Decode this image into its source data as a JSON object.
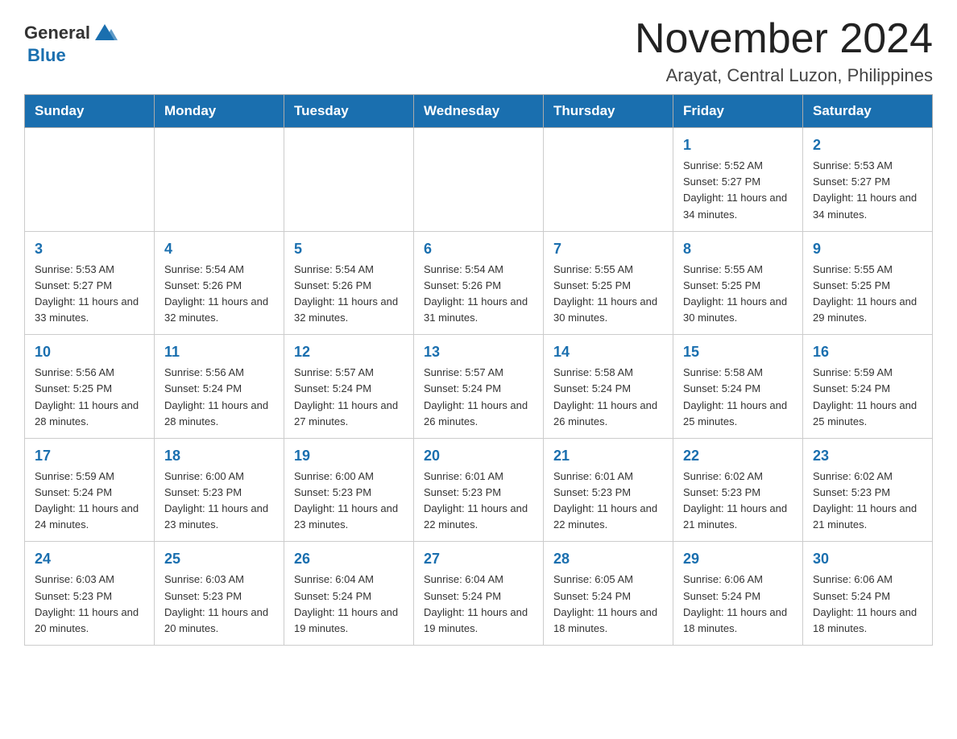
{
  "header": {
    "logo": {
      "text_general": "General",
      "text_blue": "Blue",
      "aria": "GeneralBlue logo"
    },
    "month_title": "November 2024",
    "location": "Arayat, Central Luzon, Philippines"
  },
  "calendar": {
    "days_of_week": [
      "Sunday",
      "Monday",
      "Tuesday",
      "Wednesday",
      "Thursday",
      "Friday",
      "Saturday"
    ],
    "weeks": [
      [
        {
          "day": "",
          "sunrise": "",
          "sunset": "",
          "daylight": ""
        },
        {
          "day": "",
          "sunrise": "",
          "sunset": "",
          "daylight": ""
        },
        {
          "day": "",
          "sunrise": "",
          "sunset": "",
          "daylight": ""
        },
        {
          "day": "",
          "sunrise": "",
          "sunset": "",
          "daylight": ""
        },
        {
          "day": "",
          "sunrise": "",
          "sunset": "",
          "daylight": ""
        },
        {
          "day": "1",
          "sunrise": "Sunrise: 5:52 AM",
          "sunset": "Sunset: 5:27 PM",
          "daylight": "Daylight: 11 hours and 34 minutes."
        },
        {
          "day": "2",
          "sunrise": "Sunrise: 5:53 AM",
          "sunset": "Sunset: 5:27 PM",
          "daylight": "Daylight: 11 hours and 34 minutes."
        }
      ],
      [
        {
          "day": "3",
          "sunrise": "Sunrise: 5:53 AM",
          "sunset": "Sunset: 5:27 PM",
          "daylight": "Daylight: 11 hours and 33 minutes."
        },
        {
          "day": "4",
          "sunrise": "Sunrise: 5:54 AM",
          "sunset": "Sunset: 5:26 PM",
          "daylight": "Daylight: 11 hours and 32 minutes."
        },
        {
          "day": "5",
          "sunrise": "Sunrise: 5:54 AM",
          "sunset": "Sunset: 5:26 PM",
          "daylight": "Daylight: 11 hours and 32 minutes."
        },
        {
          "day": "6",
          "sunrise": "Sunrise: 5:54 AM",
          "sunset": "Sunset: 5:26 PM",
          "daylight": "Daylight: 11 hours and 31 minutes."
        },
        {
          "day": "7",
          "sunrise": "Sunrise: 5:55 AM",
          "sunset": "Sunset: 5:25 PM",
          "daylight": "Daylight: 11 hours and 30 minutes."
        },
        {
          "day": "8",
          "sunrise": "Sunrise: 5:55 AM",
          "sunset": "Sunset: 5:25 PM",
          "daylight": "Daylight: 11 hours and 30 minutes."
        },
        {
          "day": "9",
          "sunrise": "Sunrise: 5:55 AM",
          "sunset": "Sunset: 5:25 PM",
          "daylight": "Daylight: 11 hours and 29 minutes."
        }
      ],
      [
        {
          "day": "10",
          "sunrise": "Sunrise: 5:56 AM",
          "sunset": "Sunset: 5:25 PM",
          "daylight": "Daylight: 11 hours and 28 minutes."
        },
        {
          "day": "11",
          "sunrise": "Sunrise: 5:56 AM",
          "sunset": "Sunset: 5:24 PM",
          "daylight": "Daylight: 11 hours and 28 minutes."
        },
        {
          "day": "12",
          "sunrise": "Sunrise: 5:57 AM",
          "sunset": "Sunset: 5:24 PM",
          "daylight": "Daylight: 11 hours and 27 minutes."
        },
        {
          "day": "13",
          "sunrise": "Sunrise: 5:57 AM",
          "sunset": "Sunset: 5:24 PM",
          "daylight": "Daylight: 11 hours and 26 minutes."
        },
        {
          "day": "14",
          "sunrise": "Sunrise: 5:58 AM",
          "sunset": "Sunset: 5:24 PM",
          "daylight": "Daylight: 11 hours and 26 minutes."
        },
        {
          "day": "15",
          "sunrise": "Sunrise: 5:58 AM",
          "sunset": "Sunset: 5:24 PM",
          "daylight": "Daylight: 11 hours and 25 minutes."
        },
        {
          "day": "16",
          "sunrise": "Sunrise: 5:59 AM",
          "sunset": "Sunset: 5:24 PM",
          "daylight": "Daylight: 11 hours and 25 minutes."
        }
      ],
      [
        {
          "day": "17",
          "sunrise": "Sunrise: 5:59 AM",
          "sunset": "Sunset: 5:24 PM",
          "daylight": "Daylight: 11 hours and 24 minutes."
        },
        {
          "day": "18",
          "sunrise": "Sunrise: 6:00 AM",
          "sunset": "Sunset: 5:23 PM",
          "daylight": "Daylight: 11 hours and 23 minutes."
        },
        {
          "day": "19",
          "sunrise": "Sunrise: 6:00 AM",
          "sunset": "Sunset: 5:23 PM",
          "daylight": "Daylight: 11 hours and 23 minutes."
        },
        {
          "day": "20",
          "sunrise": "Sunrise: 6:01 AM",
          "sunset": "Sunset: 5:23 PM",
          "daylight": "Daylight: 11 hours and 22 minutes."
        },
        {
          "day": "21",
          "sunrise": "Sunrise: 6:01 AM",
          "sunset": "Sunset: 5:23 PM",
          "daylight": "Daylight: 11 hours and 22 minutes."
        },
        {
          "day": "22",
          "sunrise": "Sunrise: 6:02 AM",
          "sunset": "Sunset: 5:23 PM",
          "daylight": "Daylight: 11 hours and 21 minutes."
        },
        {
          "day": "23",
          "sunrise": "Sunrise: 6:02 AM",
          "sunset": "Sunset: 5:23 PM",
          "daylight": "Daylight: 11 hours and 21 minutes."
        }
      ],
      [
        {
          "day": "24",
          "sunrise": "Sunrise: 6:03 AM",
          "sunset": "Sunset: 5:23 PM",
          "daylight": "Daylight: 11 hours and 20 minutes."
        },
        {
          "day": "25",
          "sunrise": "Sunrise: 6:03 AM",
          "sunset": "Sunset: 5:23 PM",
          "daylight": "Daylight: 11 hours and 20 minutes."
        },
        {
          "day": "26",
          "sunrise": "Sunrise: 6:04 AM",
          "sunset": "Sunset: 5:24 PM",
          "daylight": "Daylight: 11 hours and 19 minutes."
        },
        {
          "day": "27",
          "sunrise": "Sunrise: 6:04 AM",
          "sunset": "Sunset: 5:24 PM",
          "daylight": "Daylight: 11 hours and 19 minutes."
        },
        {
          "day": "28",
          "sunrise": "Sunrise: 6:05 AM",
          "sunset": "Sunset: 5:24 PM",
          "daylight": "Daylight: 11 hours and 18 minutes."
        },
        {
          "day": "29",
          "sunrise": "Sunrise: 6:06 AM",
          "sunset": "Sunset: 5:24 PM",
          "daylight": "Daylight: 11 hours and 18 minutes."
        },
        {
          "day": "30",
          "sunrise": "Sunrise: 6:06 AM",
          "sunset": "Sunset: 5:24 PM",
          "daylight": "Daylight: 11 hours and 18 minutes."
        }
      ]
    ]
  }
}
